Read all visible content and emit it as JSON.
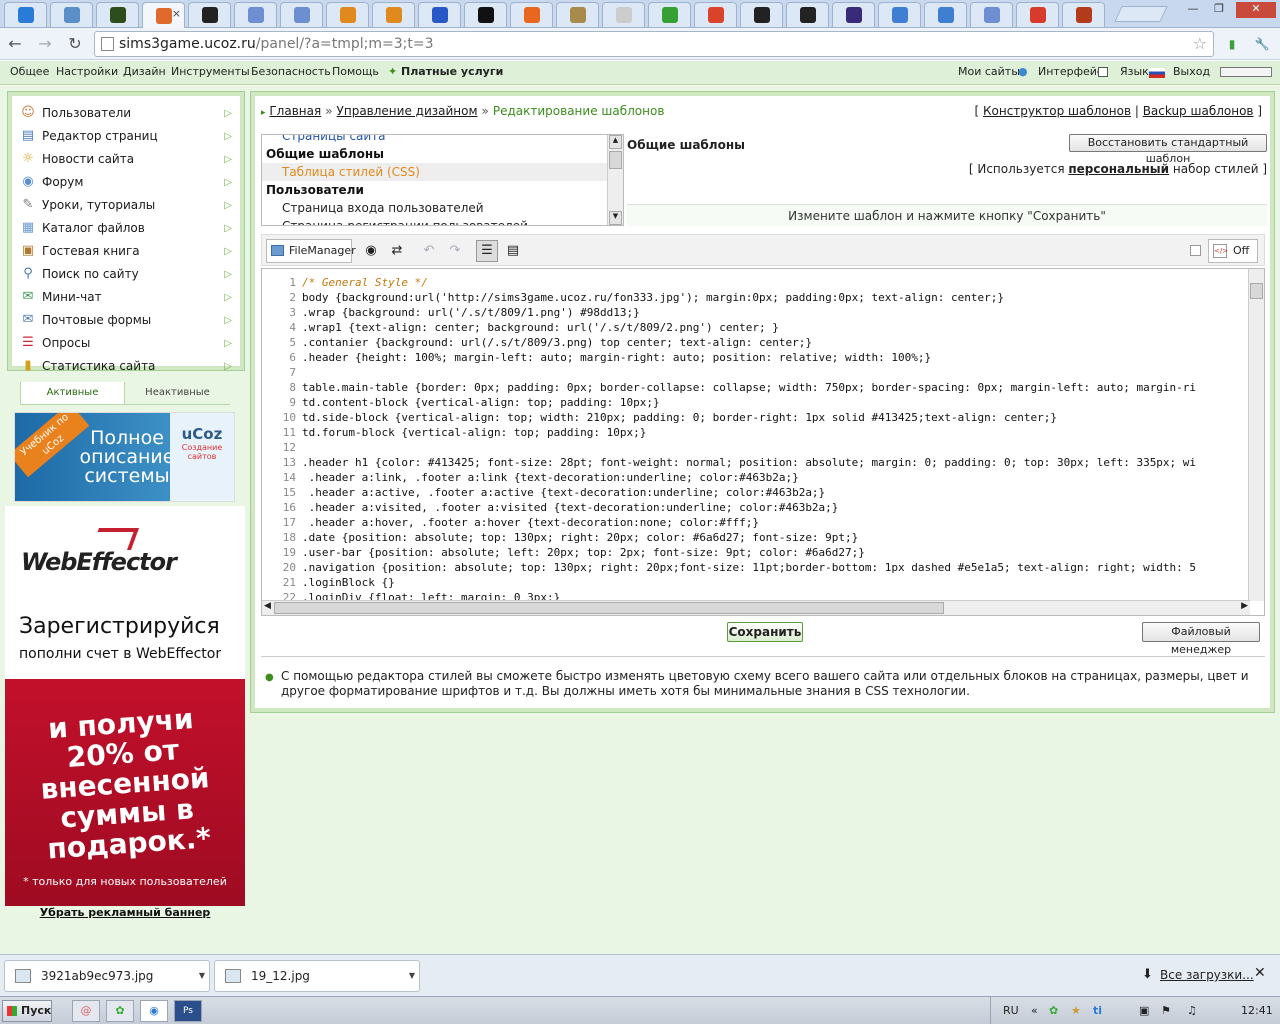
{
  "browser": {
    "url_host": "sims3game.ucoz.ru",
    "url_rest": "/panel/?a=tmpl;m=3;t=3",
    "tab_colors": [
      "#2a7ad8",
      "#5a8fc8",
      "#2e4d1d",
      "#e06a2b",
      "#222222",
      "#6d8ed1",
      "#6d8ed1",
      "#e08a1e",
      "#e08a1e",
      "#2a57c8",
      "#111111",
      "#e8661d",
      "#a88a4d",
      "#cccccc",
      "#37a035",
      "#d8432a",
      "#222222",
      "#222222",
      "#3a2b7a",
      "#3f7fd1",
      "#3f7fd1",
      "#6d8ed1",
      "#d83b2b",
      "#b33a1a"
    ],
    "active_tab": 3,
    "window_buttons": [
      "—",
      "❐",
      "✕"
    ]
  },
  "menubar": {
    "left": [
      "Общее",
      "Настройки",
      "Дизайн",
      "Инструменты",
      "Безопасность",
      "Помощь"
    ],
    "paid": "Платные услуги",
    "right": {
      "sites": "Мои сайты",
      "interface": "Интерфейс",
      "lang": "Язык",
      "exit": "Выход"
    }
  },
  "sidebar": {
    "items": [
      {
        "label": "Пользователи",
        "icon": "user-icon"
      },
      {
        "label": "Редактор страниц",
        "icon": "page-icon"
      },
      {
        "label": "Новости сайта",
        "icon": "bulb-icon"
      },
      {
        "label": "Форум",
        "icon": "forum-icon"
      },
      {
        "label": "Уроки, туториалы",
        "icon": "lessons-icon"
      },
      {
        "label": "Каталог файлов",
        "icon": "files-icon"
      },
      {
        "label": "Гостевая книга",
        "icon": "guestbook-icon"
      },
      {
        "label": "Поиск по сайту",
        "icon": "search-icon"
      },
      {
        "label": "Мини-чат",
        "icon": "chat-icon"
      },
      {
        "label": "Почтовые формы",
        "icon": "mail-icon"
      },
      {
        "label": "Опросы",
        "icon": "poll-icon"
      },
      {
        "label": "Статистика сайта",
        "icon": "stats-icon"
      }
    ],
    "tab_active": "Активные",
    "tab_inactive": "Неактивные"
  },
  "promo1": {
    "ribbon": "Учебник по uCoz",
    "main": "Полное описание системы",
    "brand": "uCoz",
    "brand_sub": "Создание сайтов"
  },
  "promo2": {
    "logo": "WebEffector",
    "h1": "Зарегистрируйся",
    "h2": "пополни счет в WebEffector",
    "offer": "и получи 20% от внесенной суммы в подарок.*",
    "footnote": "* только для новых пользователей"
  },
  "remove_ad": "Убрать рекламный баннер",
  "breadcrumb": {
    "home": "Главная",
    "design": "Управление дизайном",
    "current": "Редактирование шаблонов"
  },
  "top_links": {
    "constructor": "Конструктор шаблонов",
    "backup": "Backup шаблонов"
  },
  "template_list": [
    {
      "text": "Страницы сайта",
      "kind": "item"
    },
    {
      "text": "Общие шаблоны",
      "kind": "group"
    },
    {
      "text": "Таблица стилей (CSS)",
      "kind": "selected"
    },
    {
      "text": "Пользователи",
      "kind": "group"
    },
    {
      "text": "Страница входа пользователей",
      "kind": "item"
    },
    {
      "text": "Страница регистрации пользователей",
      "kind": "item"
    }
  ],
  "template_info": {
    "title": "Общие шаблоны",
    "restore_button": "Восстановить стандартный шаблон",
    "usage_pre": "[ Используется",
    "usage_bold": "персональный",
    "usage_post": "набор стилей ]",
    "hint": "Измените шаблон и нажмите кнопку \"Сохранить\""
  },
  "editor_toolbar": {
    "filemanager": "FileManager",
    "off": "Off"
  },
  "code_lines": [
    "/* General Style */",
    "body {background:url('http://sims3game.ucoz.ru/fon333.jpg'); margin:0px; padding:0px; text-align: center;}",
    ".wrap {background: url('/.s/t/809/1.png') #98dd13;}",
    ".wrap1 {text-align: center; background: url('/.s/t/809/2.png') center; }",
    ".contanier {background: url(/.s/t/809/3.png) top center; text-align: center;}",
    ".header {height: 100%; margin-left: auto; margin-right: auto; position: relative; width: 100%;}",
    "",
    "table.main-table {border: 0px; padding: 0px; border-collapse: collapse; width: 750px; border-spacing: 0px; margin-left: auto; margin-ri",
    "td.content-block {vertical-align: top; padding: 10px;}",
    "td.side-block {vertical-align: top; width: 210px; padding: 0; border-right: 1px solid #413425;text-align: center;}",
    "td.forum-block {vertical-align: top; padding: 10px;}",
    "",
    ".header h1 {color: #413425; font-size: 28pt; font-weight: normal; position: absolute; margin: 0; padding: 0; top: 30px; left: 335px; wi",
    " .header a:link, .footer a:link {text-decoration:underline; color:#463b2a;}",
    " .header a:active, .footer a:active {text-decoration:underline; color:#463b2a;}",
    " .header a:visited, .footer a:visited {text-decoration:underline; color:#463b2a;}",
    " .header a:hover, .footer a:hover {text-decoration:none; color:#fff;}",
    ".date {position: absolute; top: 130px; right: 20px; color: #6a6d27; font-size: 9pt;}",
    ".user-bar {position: absolute; left: 20px; top: 2px; font-size: 9pt; color: #6a6d27;}",
    ".navigation {position: absolute; top: 130px; right: 20px;font-size: 11pt;border-bottom: 1px dashed #e5e1a5; text-align: right; width: 5",
    ".loginBlock {}",
    ".loginDiv {float: left; margin: 0 3px;}"
  ],
  "buttons": {
    "save": "Сохранить",
    "filemanager": "Файловый менеджер"
  },
  "description": "С помощью редактора стилей вы сможете быстро изменять цветовую схему всего вашего сайта или отдельных блоков на страницах, размеры, цвет и другое форматирование шрифтов и т.д. Вы должны иметь хотя бы минимальные знания в CSS технологии.",
  "downloads": {
    "files": [
      "3921ab9ec973.jpg",
      "19_12.jpg"
    ],
    "all": "Все загрузки..."
  },
  "taskbar": {
    "start": "Пуск",
    "lang": "RU",
    "time": "12:41"
  }
}
